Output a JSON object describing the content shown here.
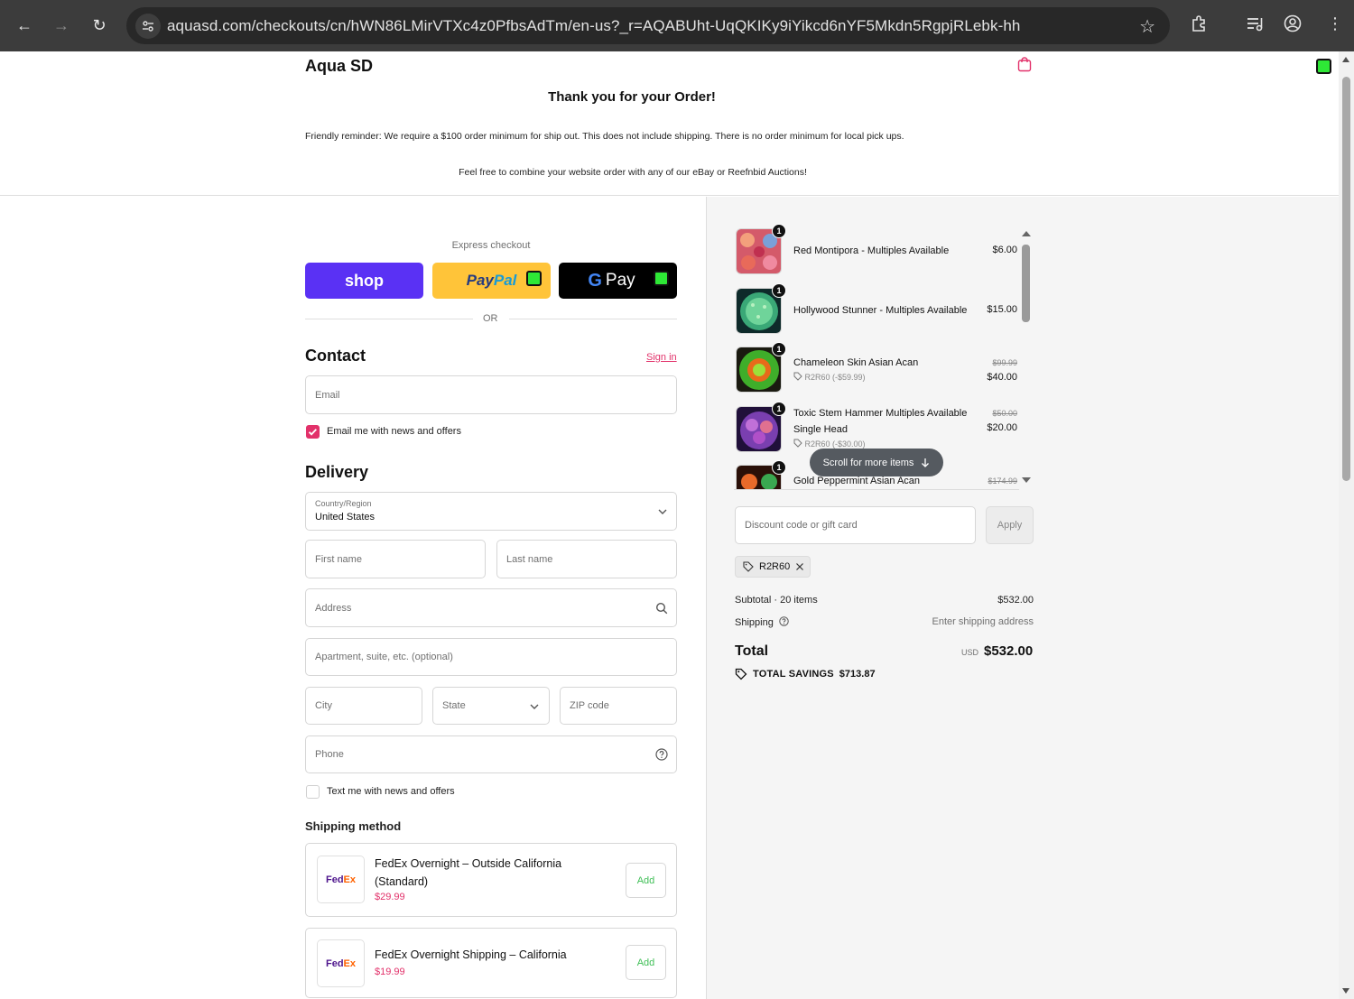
{
  "browser": {
    "url": "aquasd.com/checkouts/cn/hWN86LMirVTXc4z0PfbsAdTm/en-us?_r=AQABUht-UqQKIKy9iYikcd6nYF5Mkdn5RgpjRLebk-hh"
  },
  "header": {
    "brand": "Aqua SD",
    "thanks": "Thank you for your Order!",
    "reminder": "Friendly reminder: We require a $100 order minimum for ship out. This does not include shipping. There is no order minimum for local pick ups.",
    "combine": "Feel free to combine your website order with any of our eBay or Reefnbid Auctions!"
  },
  "express": {
    "label": "Express checkout",
    "shop_label": "shop",
    "paypal_label": "PayPal",
    "gpay_label": "Pay",
    "or_label": "OR"
  },
  "contact": {
    "title": "Contact",
    "sign_in": "Sign in",
    "email_placeholder": "Email",
    "news_label": "Email me with news and offers",
    "news_checked": true
  },
  "delivery": {
    "title": "Delivery",
    "country_label": "Country/Region",
    "country_value": "United States",
    "first_name": "First name",
    "last_name": "Last name",
    "address": "Address",
    "apartment": "Apartment, suite, etc. (optional)",
    "city": "City",
    "state": "State",
    "zip": "ZIP code",
    "phone": "Phone",
    "text_label": "Text me with news and offers",
    "text_checked": false
  },
  "shipping": {
    "title": "Shipping method",
    "options": [
      {
        "name": "FedEx Overnight – Outside California (Standard)",
        "price": "$29.99",
        "action": "Add"
      },
      {
        "name": "FedEx Overnight Shipping – California",
        "price": "$19.99",
        "action": "Add"
      }
    ]
  },
  "cart": {
    "items": [
      {
        "qty": "1",
        "name": "Red Montipora - Multiples Available",
        "price": "$6.00",
        "old_price": "",
        "discount": ""
      },
      {
        "qty": "1",
        "name": "Hollywood Stunner - Multiples Available",
        "price": "$15.00",
        "old_price": "",
        "discount": ""
      },
      {
        "qty": "1",
        "name": "Chameleon Skin Asian Acan",
        "price": "$40.00",
        "old_price": "$99.99",
        "discount": "R2R60 (-$59.99)"
      },
      {
        "qty": "1",
        "name": "Toxic Stem Hammer Multiples Available",
        "variant": "Single Head",
        "price": "$20.00",
        "old_price": "$50.00",
        "discount": "R2R60 (-$30.00)"
      },
      {
        "qty": "1",
        "name": "Gold Peppermint Asian Acan",
        "price": "",
        "old_price": "$174.99",
        "discount": ""
      }
    ],
    "scroll_hint": "Scroll for more items",
    "discount_placeholder": "Discount code or gift card",
    "apply_label": "Apply",
    "applied_code": "R2R60"
  },
  "summary": {
    "subtotal_label": "Subtotal · 20 items",
    "subtotal_value": "$532.00",
    "shipping_label": "Shipping",
    "shipping_value": "Enter shipping address",
    "total_label": "Total",
    "currency": "USD",
    "total_value": "$532.00",
    "savings_label": "TOTAL SAVINGS",
    "savings_value": "$713.87"
  },
  "colors": {
    "accent": "#e2316a",
    "shop": "#5a31f4",
    "paypal": "#ffc439",
    "add_green": "#3fbf56"
  }
}
